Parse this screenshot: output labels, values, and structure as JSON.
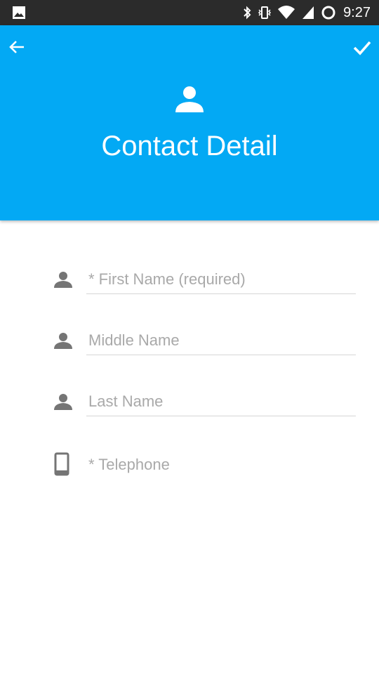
{
  "status_bar": {
    "time": "9:27",
    "icons": [
      "image-icon",
      "bluetooth-icon",
      "vibrate-icon",
      "wifi-icon",
      "signal-icon",
      "battery-ring-icon"
    ]
  },
  "header": {
    "title": "Contact Detail",
    "background_color": "#03a9f4",
    "back_icon": "arrow-back-icon",
    "confirm_icon": "checkmark-icon",
    "avatar_icon": "person-icon"
  },
  "form": {
    "fields": [
      {
        "icon": "person-icon",
        "placeholder": "* First Name (required)",
        "value": ""
      },
      {
        "icon": "person-icon",
        "placeholder": "Middle Name",
        "value": ""
      },
      {
        "icon": "person-icon",
        "placeholder": "Last Name",
        "value": ""
      },
      {
        "icon": "phone-icon",
        "placeholder": "* Telephone",
        "value": ""
      }
    ]
  }
}
